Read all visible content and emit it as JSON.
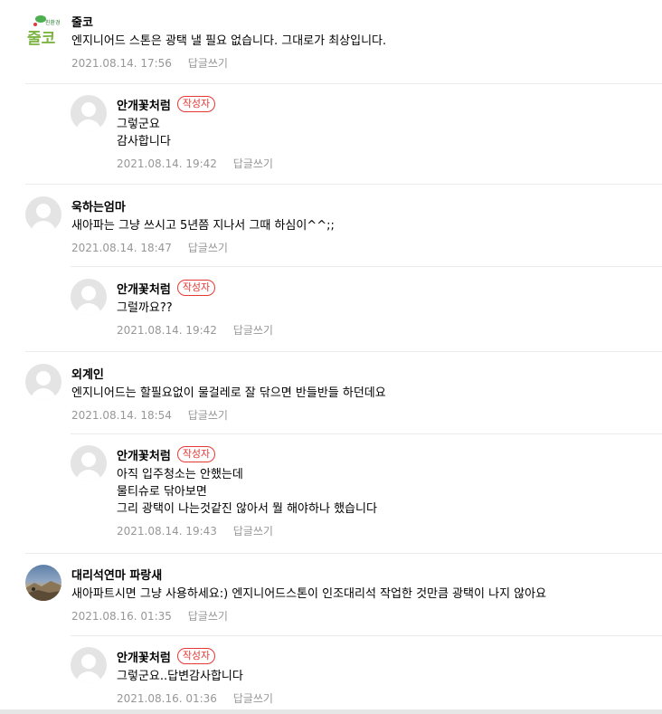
{
  "reply_label": "답글쓰기",
  "author_badge": "작성자",
  "comments": [
    {
      "nick": "줄코",
      "text": "엔지니어드 스톤은 광택 낼 필요 없습니다. 그대로가 최상입니다.",
      "date": "2021.08.14. 17:56",
      "logo_text": "줄코",
      "logo_small": "친환경"
    },
    {
      "nick": "안개꽃처럼",
      "text": "그렇군요\n감사합니다",
      "date": "2021.08.14. 19:42"
    },
    {
      "nick": "욱하는엄마",
      "text": "새아파는 그냥 쓰시고 5년쯤 지나서 그때 하심이^^;;",
      "date": "2021.08.14. 18:47"
    },
    {
      "nick": "안개꽃처럼",
      "text": "그럴까요??",
      "date": "2021.08.14. 19:42"
    },
    {
      "nick": "외계인",
      "text": "엔지니어드는 할필요없이 물걸레로 잘 닦으면 반들반들 하던데요",
      "date": "2021.08.14. 18:54"
    },
    {
      "nick": "안개꽃처럼",
      "text": "아직 입주청소는 안했는데\n물티슈로 닦아보면\n그리 광택이 나는것같진 않아서 뭘 해야하나 했습니다",
      "date": "2021.08.14. 19:43"
    },
    {
      "nick": "대리석연마 파랑새",
      "text": "새아파트시면 그냥 사용하세요:) 엔지니어드스톤이 인조대리석 작업한 것만큼 광택이 나지 않아요",
      "date": "2021.08.16. 01:35"
    },
    {
      "nick": "안개꽃처럼",
      "text": "그렇군요..답변감사합니다",
      "date": "2021.08.16. 01:36"
    }
  ]
}
